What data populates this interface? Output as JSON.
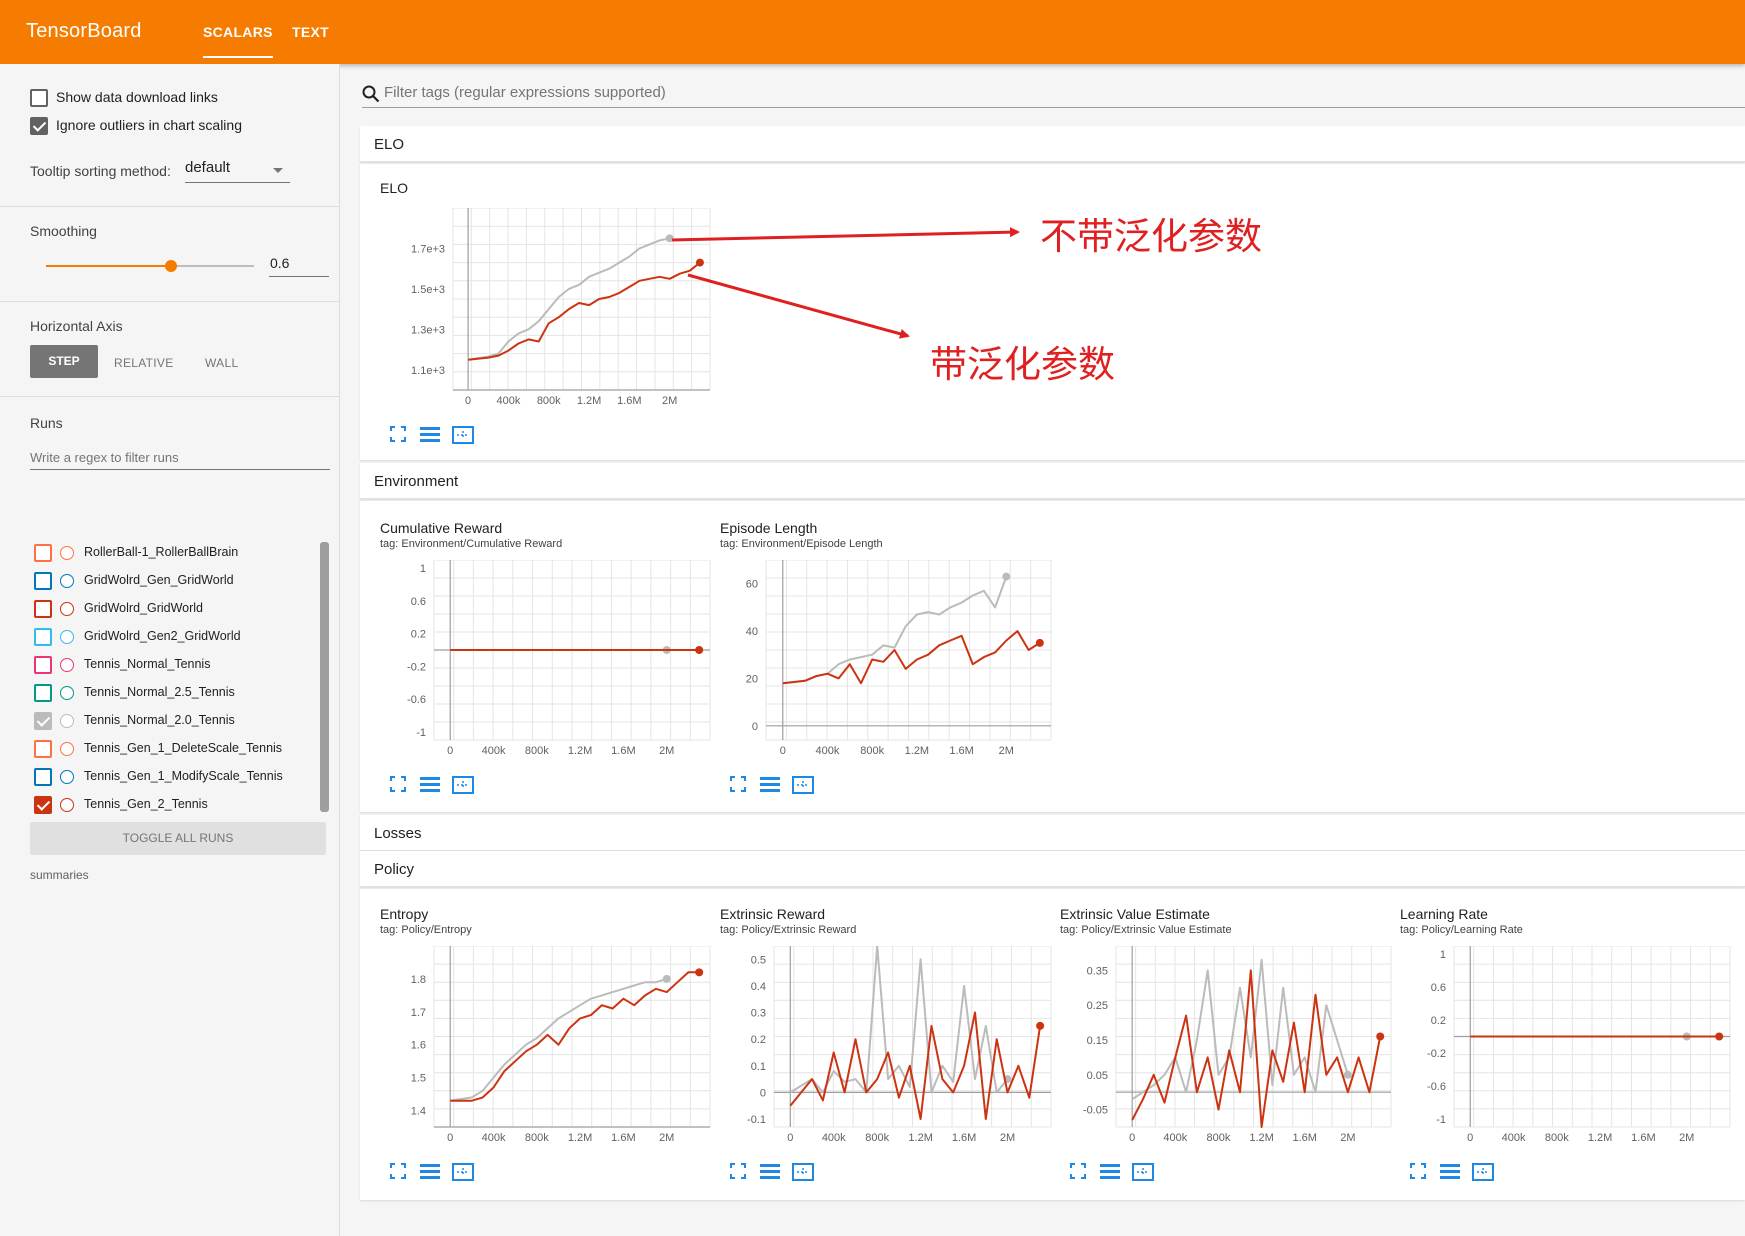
{
  "app": {
    "brand": "TensorBoard",
    "tabs": [
      {
        "label": "SCALARS",
        "active": true
      },
      {
        "label": "TEXT",
        "active": false
      }
    ],
    "accent_color": "#f57c00"
  },
  "sidebar": {
    "show_download_links": {
      "label": "Show data download links",
      "checked": false
    },
    "ignore_outliers": {
      "label": "Ignore outliers in chart scaling",
      "checked": true
    },
    "tooltip_sorting": {
      "label": "Tooltip sorting method:",
      "value": "default"
    },
    "smoothing": {
      "label": "Smoothing",
      "value": "0.6",
      "fraction": 0.6
    },
    "horizontal_axis": {
      "label": "Horizontal Axis",
      "options": [
        "STEP",
        "RELATIVE",
        "WALL"
      ],
      "selected": "STEP"
    },
    "runs": {
      "label": "Runs",
      "filter_placeholder": "Write a regex to filter runs",
      "items": [
        {
          "name": "RollerBall-1_RollerBallBrain",
          "color": "#ff7043",
          "checked": false
        },
        {
          "name": "GridWolrd_Gen_GridWorld",
          "color": "#0077bb",
          "checked": false
        },
        {
          "name": "GridWolrd_GridWorld",
          "color": "#cc3311",
          "checked": false
        },
        {
          "name": "GridWolrd_Gen2_GridWorld",
          "color": "#33bbee",
          "checked": false
        },
        {
          "name": "Tennis_Normal_Tennis",
          "color": "#ee3377",
          "checked": false
        },
        {
          "name": "Tennis_Normal_2.5_Tennis",
          "color": "#009988",
          "checked": false
        },
        {
          "name": "Tennis_Normal_2.0_Tennis",
          "color": "#bbbbbb",
          "checked": true
        },
        {
          "name": "Tennis_Gen_1_DeleteScale_Tennis",
          "color": "#ff7043",
          "checked": false
        },
        {
          "name": "Tennis_Gen_1_ModifyScale_Tennis",
          "color": "#0077bb",
          "checked": false
        },
        {
          "name": "Tennis_Gen_2_Tennis",
          "color": "#cc3311",
          "checked": true
        }
      ],
      "toggle_all_label": "TOGGLE ALL RUNS",
      "footer": "summaries"
    }
  },
  "main": {
    "filter_placeholder": "Filter tags (regular expressions supported)",
    "groups": {
      "elo": "ELO",
      "environment": "Environment",
      "losses": "Losses",
      "policy": "Policy"
    },
    "cards": {
      "elo": {
        "title": "ELO",
        "tag": ""
      },
      "cumulative_reward": {
        "title": "Cumulative Reward",
        "tag": "tag: Environment/Cumulative Reward"
      },
      "episode_length": {
        "title": "Episode Length",
        "tag": "tag: Environment/Episode Length"
      },
      "entropy": {
        "title": "Entropy",
        "tag": "tag: Policy/Entropy"
      },
      "extrinsic_reward": {
        "title": "Extrinsic Reward",
        "tag": "tag: Policy/Extrinsic Reward"
      },
      "extrinsic_value": {
        "title": "Extrinsic Value Estimate",
        "tag": "tag: Policy/Extrinsic Value Estimate"
      },
      "learning_rate": {
        "title": "Learning Rate",
        "tag": "tag: Policy/Learning Rate"
      }
    },
    "annotations": {
      "without_generalization": "不带泛化参数",
      "with_generalization": "带泛化参数"
    }
  },
  "chart_data": [
    {
      "id": "elo",
      "type": "line",
      "x_ticks": [
        "0",
        "400k",
        "800k",
        "1.2M",
        "1.6M",
        "2M"
      ],
      "y_ticks": [
        "1.1e+3",
        "1.3e+3",
        "1.5e+3",
        "1.7e+3"
      ],
      "xlim": [
        -150000,
        2400000
      ],
      "ylim": [
        1000,
        1900
      ],
      "series": [
        {
          "color": "#bbbbbb",
          "x": [
            0,
            200000,
            300000,
            400000,
            500000,
            600000,
            700000,
            800000,
            900000,
            1000000,
            1100000,
            1200000,
            1300000,
            1400000,
            1500000,
            1600000,
            1700000,
            1800000,
            1900000,
            2000000
          ],
          "y": [
            1150,
            1165,
            1180,
            1240,
            1280,
            1300,
            1340,
            1400,
            1460,
            1500,
            1520,
            1560,
            1580,
            1600,
            1630,
            1660,
            1700,
            1720,
            1740,
            1750
          ]
        },
        {
          "color": "#cc3311",
          "x": [
            0,
            200000,
            300000,
            400000,
            500000,
            600000,
            700000,
            800000,
            900000,
            1000000,
            1100000,
            1200000,
            1300000,
            1400000,
            1500000,
            1600000,
            1700000,
            1800000,
            1900000,
            2000000,
            2100000,
            2200000,
            2300000
          ],
          "y": [
            1150,
            1160,
            1170,
            1195,
            1230,
            1250,
            1240,
            1330,
            1360,
            1400,
            1430,
            1420,
            1450,
            1460,
            1480,
            1510,
            1540,
            1550,
            1560,
            1550,
            1575,
            1590,
            1630
          ]
        }
      ]
    },
    {
      "id": "cumulative_reward",
      "type": "line",
      "x_ticks": [
        "0",
        "400k",
        "800k",
        "1.2M",
        "1.6M",
        "2M"
      ],
      "y_ticks": [
        "-1",
        "-0.6",
        "-0.2",
        "0.2",
        "0.6",
        "1"
      ],
      "xlim": [
        -150000,
        2400000
      ],
      "ylim": [
        -1.1,
        1.1
      ],
      "series": [
        {
          "color": "#bbbbbb",
          "x": [
            0,
            2000000
          ],
          "y": [
            0,
            0
          ]
        },
        {
          "color": "#cc3311",
          "x": [
            0,
            2300000
          ],
          "y": [
            0,
            0
          ]
        }
      ]
    },
    {
      "id": "episode_length",
      "type": "line",
      "x_ticks": [
        "0",
        "400k",
        "800k",
        "1.2M",
        "1.6M",
        "2M"
      ],
      "y_ticks": [
        "0",
        "20",
        "40",
        "60"
      ],
      "xlim": [
        -150000,
        2400000
      ],
      "ylim": [
        -6,
        70
      ],
      "series": [
        {
          "color": "#bbbbbb",
          "x": [
            0,
            200000,
            300000,
            400000,
            500000,
            600000,
            700000,
            800000,
            900000,
            1000000,
            1100000,
            1200000,
            1300000,
            1400000,
            1500000,
            1600000,
            1700000,
            1800000,
            1900000,
            2000000
          ],
          "y": [
            18,
            19,
            21,
            22,
            26,
            28,
            29,
            30,
            34,
            33,
            42,
            47,
            48,
            47,
            50,
            52,
            55,
            57,
            50,
            63
          ]
        },
        {
          "color": "#cc3311",
          "x": [
            0,
            200000,
            300000,
            400000,
            500000,
            600000,
            700000,
            800000,
            900000,
            1000000,
            1100000,
            1200000,
            1300000,
            1400000,
            1500000,
            1600000,
            1700000,
            1800000,
            1900000,
            2000000,
            2100000,
            2200000,
            2300000
          ],
          "y": [
            18,
            19,
            21,
            22,
            20,
            26,
            18,
            28,
            27,
            32,
            24,
            28,
            30,
            34,
            36,
            38,
            26,
            29,
            31,
            36,
            40,
            32,
            35
          ]
        }
      ]
    },
    {
      "id": "entropy",
      "type": "line",
      "x_ticks": [
        "0",
        "400k",
        "800k",
        "1.2M",
        "1.6M",
        "2M"
      ],
      "y_ticks": [
        "1.4",
        "1.5",
        "1.6",
        "1.7",
        "1.8"
      ],
      "xlim": [
        -150000,
        2400000
      ],
      "ylim": [
        1.35,
        1.9
      ],
      "series": [
        {
          "color": "#bbbbbb",
          "x": [
            0,
            200000,
            300000,
            400000,
            500000,
            600000,
            700000,
            800000,
            900000,
            1000000,
            1100000,
            1200000,
            1300000,
            1400000,
            1500000,
            1600000,
            1700000,
            1800000,
            1900000,
            2000000
          ],
          "y": [
            1.43,
            1.44,
            1.46,
            1.5,
            1.54,
            1.57,
            1.6,
            1.62,
            1.65,
            1.68,
            1.7,
            1.72,
            1.74,
            1.75,
            1.76,
            1.77,
            1.78,
            1.79,
            1.79,
            1.8
          ]
        },
        {
          "color": "#cc3311",
          "x": [
            0,
            200000,
            300000,
            400000,
            500000,
            600000,
            700000,
            800000,
            900000,
            1000000,
            1100000,
            1200000,
            1300000,
            1400000,
            1500000,
            1600000,
            1700000,
            1800000,
            1900000,
            2000000,
            2100000,
            2200000,
            2300000
          ],
          "y": [
            1.43,
            1.43,
            1.44,
            1.47,
            1.52,
            1.55,
            1.58,
            1.6,
            1.63,
            1.6,
            1.65,
            1.68,
            1.69,
            1.72,
            1.71,
            1.74,
            1.72,
            1.75,
            1.77,
            1.76,
            1.79,
            1.82,
            1.82
          ]
        }
      ]
    },
    {
      "id": "extrinsic_reward",
      "type": "line",
      "x_ticks": [
        "0",
        "400k",
        "800k",
        "1.2M",
        "1.6M",
        "2M"
      ],
      "y_ticks": [
        "-0.1",
        "0",
        "0.1",
        "0.2",
        "0.3",
        "0.4",
        "0.5"
      ],
      "xlim": [
        -150000,
        2400000
      ],
      "ylim": [
        -0.13,
        0.55
      ],
      "series": [
        {
          "color": "#bbbbbb",
          "x": [
            0,
            200000,
            300000,
            400000,
            500000,
            600000,
            700000,
            800000,
            900000,
            1000000,
            1100000,
            1200000,
            1300000,
            1400000,
            1500000,
            1600000,
            1700000,
            1800000,
            1900000,
            2000000
          ],
          "y": [
            0.0,
            0.05,
            0.0,
            0.08,
            0.04,
            0.05,
            0.0,
            0.55,
            0.05,
            0.1,
            0.02,
            0.5,
            0.0,
            0.1,
            0.04,
            0.4,
            0.05,
            0.25,
            0.0,
            0.05
          ]
        },
        {
          "color": "#cc3311",
          "x": [
            0,
            100000,
            200000,
            300000,
            400000,
            500000,
            600000,
            700000,
            800000,
            900000,
            1000000,
            1100000,
            1200000,
            1300000,
            1400000,
            1500000,
            1600000,
            1700000,
            1800000,
            1900000,
            2000000,
            2100000,
            2200000,
            2300000
          ],
          "y": [
            -0.05,
            0.0,
            0.05,
            -0.03,
            0.15,
            0.0,
            0.2,
            0.0,
            0.05,
            0.15,
            -0.02,
            0.1,
            -0.1,
            0.25,
            0.05,
            0.0,
            0.1,
            0.3,
            -0.1,
            0.2,
            0.0,
            0.1,
            -0.02,
            0.25
          ]
        }
      ]
    },
    {
      "id": "extrinsic_value",
      "type": "line",
      "x_ticks": [
        "0",
        "400k",
        "800k",
        "1.2M",
        "1.6M",
        "2M"
      ],
      "y_ticks": [
        "-0.05",
        "0.05",
        "0.15",
        "0.25",
        "0.35"
      ],
      "xlim": [
        -150000,
        2400000
      ],
      "ylim": [
        -0.1,
        0.42
      ],
      "series": [
        {
          "color": "#bbbbbb",
          "x": [
            0,
            200000,
            300000,
            400000,
            500000,
            600000,
            700000,
            800000,
            900000,
            1000000,
            1100000,
            1200000,
            1300000,
            1400000,
            1500000,
            1600000,
            1700000,
            1800000,
            1900000,
            2000000
          ],
          "y": [
            -0.02,
            0.02,
            0.05,
            0.1,
            0.0,
            0.15,
            0.35,
            0.05,
            0.1,
            0.3,
            0.1,
            0.38,
            0.02,
            0.3,
            0.05,
            0.1,
            0.0,
            0.25,
            0.15,
            0.05
          ]
        },
        {
          "color": "#cc3311",
          "x": [
            0,
            100000,
            200000,
            300000,
            400000,
            500000,
            600000,
            700000,
            800000,
            900000,
            1000000,
            1100000,
            1200000,
            1300000,
            1400000,
            1500000,
            1600000,
            1700000,
            1800000,
            1900000,
            2000000,
            2100000,
            2200000,
            2300000
          ],
          "y": [
            -0.08,
            -0.02,
            0.05,
            -0.03,
            0.1,
            0.22,
            0.0,
            0.1,
            -0.05,
            0.12,
            0.0,
            0.35,
            -0.1,
            0.12,
            0.03,
            0.2,
            0.0,
            0.28,
            0.05,
            0.1,
            0.0,
            0.1,
            0.0,
            0.16
          ]
        }
      ]
    },
    {
      "id": "learning_rate",
      "type": "line",
      "x_ticks": [
        "0",
        "400k",
        "800k",
        "1.2M",
        "1.6M",
        "2M"
      ],
      "y_ticks": [
        "-1",
        "-0.6",
        "-0.2",
        "0.2",
        "0.6",
        "1"
      ],
      "xlim": [
        -150000,
        2400000
      ],
      "ylim": [
        -1.1,
        1.1
      ],
      "series": [
        {
          "color": "#bbbbbb",
          "x": [
            0,
            2000000
          ],
          "y": [
            0,
            0
          ]
        },
        {
          "color": "#cc3311",
          "x": [
            0,
            2300000
          ],
          "y": [
            0,
            0
          ]
        }
      ]
    }
  ]
}
